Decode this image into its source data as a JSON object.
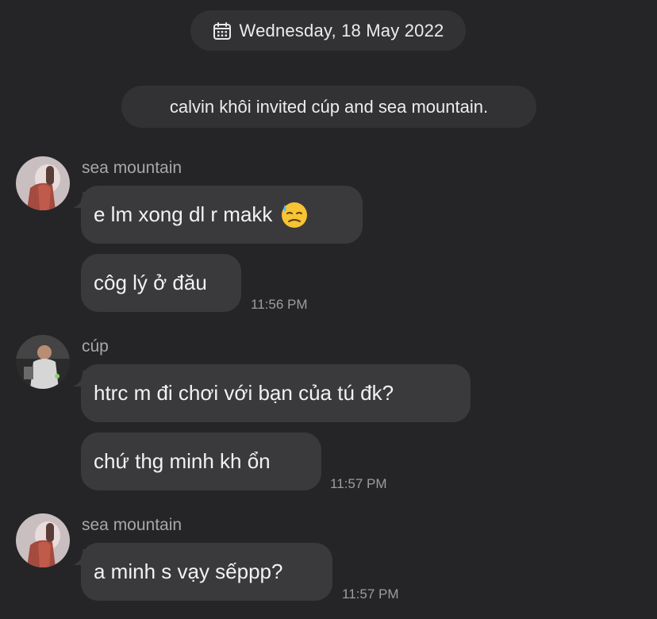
{
  "date_separator": {
    "icon": "calendar-icon",
    "text": "Wednesday, 18 May 2022"
  },
  "system_message": {
    "text": "calvin khôi invited cúp and sea mountain."
  },
  "groups": [
    {
      "sender": "sea mountain",
      "avatar": "avatar-sea-mountain",
      "messages": [
        {
          "text": "e lm xong dl r makk",
          "emoji": "downcast-sweat-face-emoji"
        },
        {
          "text": "côg lý ở đău"
        }
      ],
      "time": "11:56 PM"
    },
    {
      "sender": "cúp",
      "avatar": "avatar-cup",
      "messages": [
        {
          "text": "htrc m đi chơi với bạn của tú đk?"
        },
        {
          "text": "chứ thg minh kh ổn"
        }
      ],
      "time": "11:57 PM"
    },
    {
      "sender": "sea mountain",
      "avatar": "avatar-sea-mountain",
      "messages": [
        {
          "text": "a minh s vạy sếppp?"
        }
      ],
      "time": "11:57 PM"
    }
  ],
  "colors": {
    "background": "#252527",
    "pill": "#323235",
    "bubble": "#3a3a3d",
    "text": "#ececec",
    "meta": "#a7a7aa"
  }
}
